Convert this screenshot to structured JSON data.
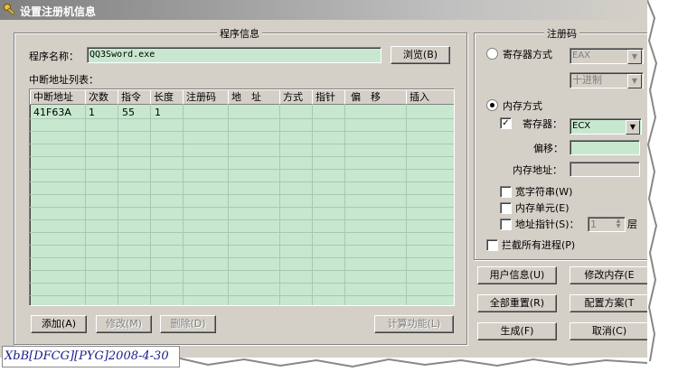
{
  "window": {
    "title": "设置注册机信息"
  },
  "program_group": {
    "title": "程序信息",
    "name_label": "程序名称：",
    "name_value": "QQ3Sword.exe",
    "browse_label": "浏览(B)",
    "list_label": "中断地址列表：",
    "columns": [
      "中断地址",
      "次数",
      "指令",
      "长度",
      "注册码",
      "地　址",
      "方式",
      "指针",
      "偏　移",
      "插入"
    ],
    "rows": [
      [
        "41F63A",
        "1",
        "55",
        "1",
        "",
        "",
        "",
        "",
        "",
        ""
      ]
    ],
    "add_label": "添加(A)",
    "modify_label": "修改(M)",
    "delete_label": "删除(D)",
    "calc_label": "计算功能(L)"
  },
  "regcode_group": {
    "title": "注册码",
    "register_mode_label": "寄存器方式",
    "register_combo": "EAX",
    "base_combo": "十进制",
    "memory_mode_label": "内存方式",
    "register_check_label": "寄存器：",
    "register_check_value": "ECX",
    "offset_label": "偏移：",
    "offset_value": "",
    "mem_addr_label": "内存地址：",
    "mem_addr_value": "",
    "wide_string_label": "宽字符串(W)",
    "mem_unit_label": "内存单元(E)",
    "addr_pointer_label": "地址指针(S)：",
    "pointer_levels_value": "1",
    "layer_label": "层",
    "intercept_all_label": "拦截所有进程(P)"
  },
  "side_buttons": {
    "user_info": "用户信息(U)",
    "modify_mem": "修改内存(E",
    "reset_all": "全部重置(R)",
    "config": "配置方案(T",
    "generate": "生成(F)",
    "cancel": "取消(C)"
  },
  "watermark": "XbB[DFCG][PYG]2008-4-30",
  "colors": {
    "edit_bg": "#c7e8cf",
    "face": "#d4d0c8"
  }
}
